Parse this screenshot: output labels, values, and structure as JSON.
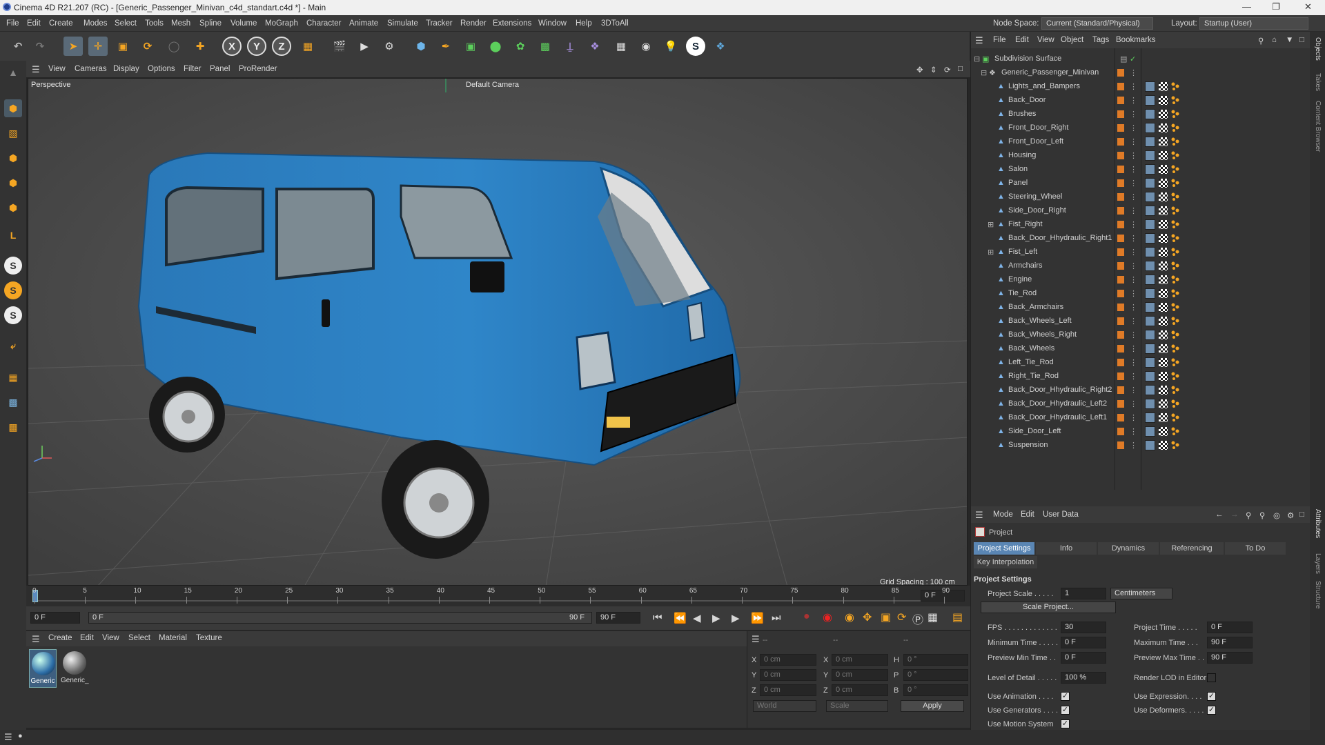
{
  "window": {
    "title": "Cinema 4D R21.207 (RC) - [Generic_Passenger_Minivan_c4d_standart.c4d *] - Main"
  },
  "menubar": {
    "items": [
      "File",
      "Edit",
      "Create",
      "Modes",
      "Select",
      "Tools",
      "Mesh",
      "Spline",
      "Volume",
      "MoGraph",
      "Character",
      "Animate",
      "Simulate",
      "Tracker",
      "Render",
      "Extensions",
      "Window",
      "Help",
      "3DToAll"
    ],
    "node_space_label": "Node Space:",
    "node_space_value": "Current (Standard/Physical)",
    "layout_label": "Layout:",
    "layout_value": "Startup (User)"
  },
  "toolbar": {
    "axis": [
      "X",
      "Y",
      "Z"
    ]
  },
  "viewport": {
    "menu": [
      "View",
      "Cameras",
      "Display",
      "Options",
      "Filter",
      "Panel",
      "ProRender"
    ],
    "name": "Perspective",
    "camera": "Default Camera",
    "grid_spacing": "Grid Spacing : 100 cm",
    "vehicle_color": "#2f86c9"
  },
  "timeline": {
    "ticks": [
      "0",
      "5",
      "10",
      "15",
      "20",
      "25",
      "30",
      "35",
      "40",
      "45",
      "50",
      "55",
      "60",
      "65",
      "70",
      "75",
      "80",
      "85",
      "90"
    ],
    "current_frame": "0 F"
  },
  "transport": {
    "start": "0 F",
    "range_start": "0 F",
    "range_end": "90 F",
    "end": "90 F"
  },
  "materials": {
    "menu": [
      "Create",
      "Edit",
      "View",
      "Select",
      "Material",
      "Texture"
    ],
    "items": [
      "Generic",
      "Generic_"
    ]
  },
  "coords": {
    "col_headers": [
      "--",
      "--",
      "--"
    ],
    "rows": [
      {
        "a": "X",
        "av": "0 cm",
        "b": "X",
        "bv": "0 cm",
        "c": "H",
        "cv": "0 °"
      },
      {
        "a": "Y",
        "av": "0 cm",
        "b": "Y",
        "bv": "0 cm",
        "c": "P",
        "cv": "0 °"
      },
      {
        "a": "Z",
        "av": "0 cm",
        "b": "Z",
        "bv": "0 cm",
        "c": "B",
        "cv": "0 °"
      }
    ],
    "mode": "World",
    "scale": "Scale",
    "apply": "Apply"
  },
  "objects": {
    "menu": [
      "File",
      "Edit",
      "View",
      "Object",
      "Tags",
      "Bookmarks"
    ],
    "root": "Subdivision Surface",
    "group": "Generic_Passenger_Minivan",
    "items": [
      "Lights_and_Bampers",
      "Back_Door",
      "Brushes",
      "Front_Door_Right",
      "Front_Door_Left",
      "Housing",
      "Salon",
      "Panel",
      "Steering_Wheel",
      "Side_Door_Right",
      "Fist_Right",
      "Back_Door_Hhydraulic_Right1",
      "Fist_Left",
      "Armchairs",
      "Engine",
      "Tie_Rod",
      "Back_Armchairs",
      "Back_Wheels_Left",
      "Back_Wheels_Right",
      "Back_Wheels",
      "Left_Tie_Rod",
      "Right_Tie_Rod",
      "Back_Door_Hhydraulic_Right2",
      "Back_Door_Hhydraulic_Left2",
      "Back_Door_Hhydraulic_Left1",
      "Side_Door_Left",
      "Suspension"
    ]
  },
  "attributes": {
    "menu": [
      "Mode",
      "Edit",
      "User Data"
    ],
    "object": "Project",
    "tabs": [
      "Project Settings",
      "Info",
      "Dynamics",
      "Referencing",
      "To Do"
    ],
    "tab2": "Key Interpolation",
    "section": "Project Settings",
    "project_scale_label": "Project Scale . . . . .",
    "project_scale": "1",
    "scale_unit": "Centimeters",
    "scale_project": "Scale Project...",
    "fps_label": "FPS . . . . . . . . . . . . .",
    "fps": "30",
    "project_time_label": "Project Time . . . . .",
    "project_time": "0 F",
    "min_time_label": "Minimum Time . . . . .",
    "min_time": "0 F",
    "max_time_label": "Maximum Time . . .",
    "max_time": "90 F",
    "prev_min_label": "Preview Min Time . .",
    "prev_min": "0 F",
    "prev_max_label": "Preview Max Time . .",
    "prev_max": "90 F",
    "lod_label": "Level of Detail . . . . .",
    "lod": "100 %",
    "render_lod_label": "Render LOD in Editor",
    "use_anim": "Use Animation . . . .",
    "use_expr": "Use Expression. . . .",
    "use_gen": "Use Generators . . . .",
    "use_def": "Use Deformers. . . . .",
    "use_motion": "Use Motion System"
  },
  "rightstrip": {
    "top": [
      "Objects",
      "Takes",
      "Content Browser"
    ],
    "bottom": [
      "Attributes",
      "Layers",
      "Structure"
    ]
  }
}
